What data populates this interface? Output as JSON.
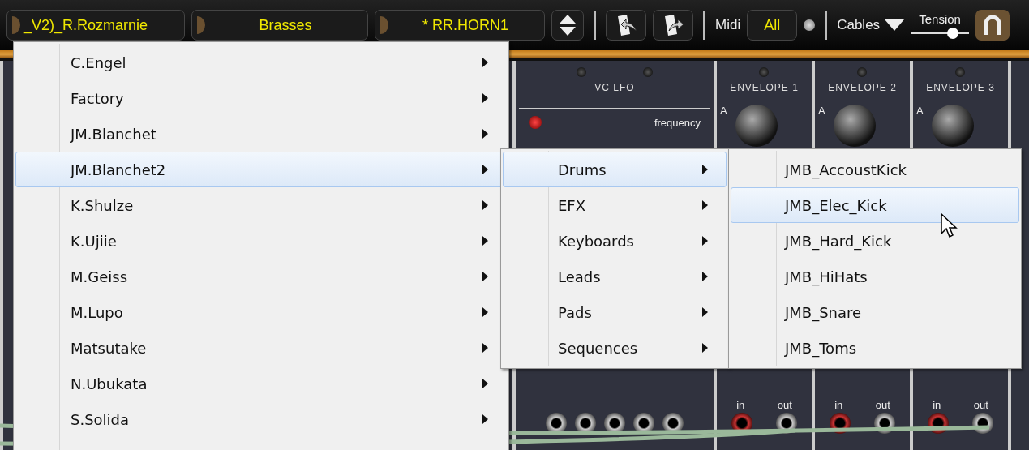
{
  "toolbar": {
    "presets": [
      {
        "label": "_V2)_R.Rozmarnie"
      },
      {
        "label": "Brasses"
      },
      {
        "label": "* RR.HORN1"
      }
    ],
    "midi_label": "Midi",
    "midi_channel": "All",
    "midi_activity": {
      "on": false
    },
    "cables_label": "Cables",
    "tension": {
      "label": "Tension",
      "level": 0.72
    }
  },
  "rack": {
    "modules": [
      {
        "kind": "filler"
      },
      {
        "kind": "lfo",
        "title": "VC LFO",
        "knob_label": "frequency"
      },
      {
        "kind": "envelope",
        "title": "ENVELOPE 1",
        "knob_label": "A",
        "in_label": "in",
        "out_label": "out"
      },
      {
        "kind": "envelope",
        "title": "ENVELOPE 2",
        "knob_label": "A",
        "in_label": "in",
        "out_label": "out"
      },
      {
        "kind": "envelope",
        "title": "ENVELOPE 3",
        "knob_label": "A",
        "in_label": "in",
        "out_label": "out"
      },
      {
        "kind": "filler"
      }
    ]
  },
  "menus": [
    {
      "items": [
        {
          "label": "C.Engel",
          "submenu": true,
          "selected": false
        },
        {
          "label": "Factory",
          "submenu": true,
          "selected": false
        },
        {
          "label": "JM.Blanchet",
          "submenu": true,
          "selected": false
        },
        {
          "label": "JM.Blanchet2",
          "submenu": true,
          "selected": true
        },
        {
          "label": "K.Shulze",
          "submenu": true,
          "selected": false
        },
        {
          "label": "K.Ujiie",
          "submenu": true,
          "selected": false
        },
        {
          "label": "M.Geiss",
          "submenu": true,
          "selected": false
        },
        {
          "label": "M.Lupo",
          "submenu": true,
          "selected": false
        },
        {
          "label": "Matsutake",
          "submenu": true,
          "selected": false
        },
        {
          "label": "N.Ubukata",
          "submenu": true,
          "selected": false
        },
        {
          "label": "S.Solida",
          "submenu": true,
          "selected": false
        }
      ]
    },
    {
      "items": [
        {
          "label": "Drums",
          "submenu": true,
          "selected": true
        },
        {
          "label": "EFX",
          "submenu": true,
          "selected": false
        },
        {
          "label": "Keyboards",
          "submenu": true,
          "selected": false
        },
        {
          "label": "Leads",
          "submenu": true,
          "selected": false
        },
        {
          "label": "Pads",
          "submenu": true,
          "selected": false
        },
        {
          "label": "Sequences",
          "submenu": true,
          "selected": false
        }
      ]
    },
    {
      "items": [
        {
          "label": "JMB_AccoustKick",
          "submenu": false,
          "selected": false
        },
        {
          "label": "JMB_Elec_Kick",
          "submenu": false,
          "selected": true
        },
        {
          "label": "JMB_Hard_Kick",
          "submenu": false,
          "selected": false
        },
        {
          "label": "JMB_HiHats",
          "submenu": false,
          "selected": false
        },
        {
          "label": "JMB_Snare",
          "submenu": false,
          "selected": false
        },
        {
          "label": "JMB_Toms",
          "submenu": false,
          "selected": false
        }
      ]
    }
  ]
}
